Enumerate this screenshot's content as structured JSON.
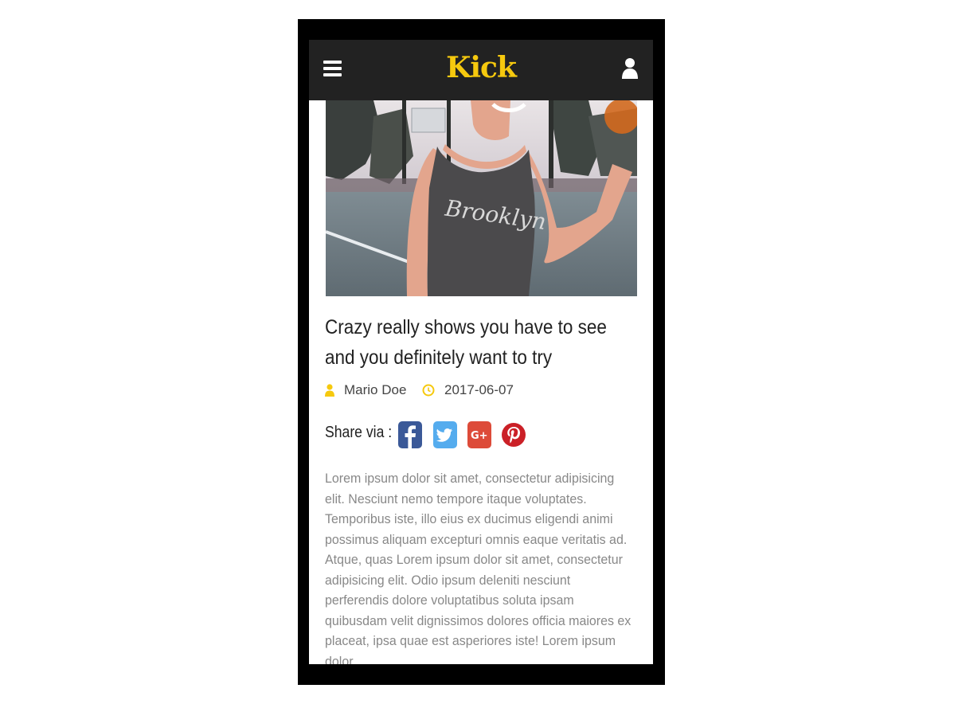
{
  "header": {
    "brand": "Kick"
  },
  "article": {
    "title": "Crazy really shows you have to see and you definitely want to try",
    "author": "Mario Doe",
    "date": "2017-06-07",
    "share_label": "Share via :",
    "share_buttons": [
      "facebook-icon",
      "twitter-icon",
      "google-plus-icon",
      "pinterest-icon"
    ],
    "body": "Lorem ipsum dolor sit amet, consectetur adipisicing elit. Nesciunt nemo tempore itaque voluptates. Temporibus iste, illo eius ex ducimus eligendi animi possimus aliquam excepturi omnis eaque veritatis ad. Atque, quas Lorem ipsum dolor sit amet, consectetur adipisicing elit. Odio ipsum deleniti nesciunt perferendis dolore voluptatibus soluta ipsam quibusdam velit dignissimos dolores officia maiores ex placeat, ipsa quae est asperiores iste! Lorem ipsum dolor"
  },
  "colors": {
    "accent": "#f6c90e",
    "topbar": "#222222",
    "facebook": "#3b5998",
    "twitter": "#55acee",
    "google_plus": "#dd4b39",
    "pinterest": "#cb2027"
  }
}
